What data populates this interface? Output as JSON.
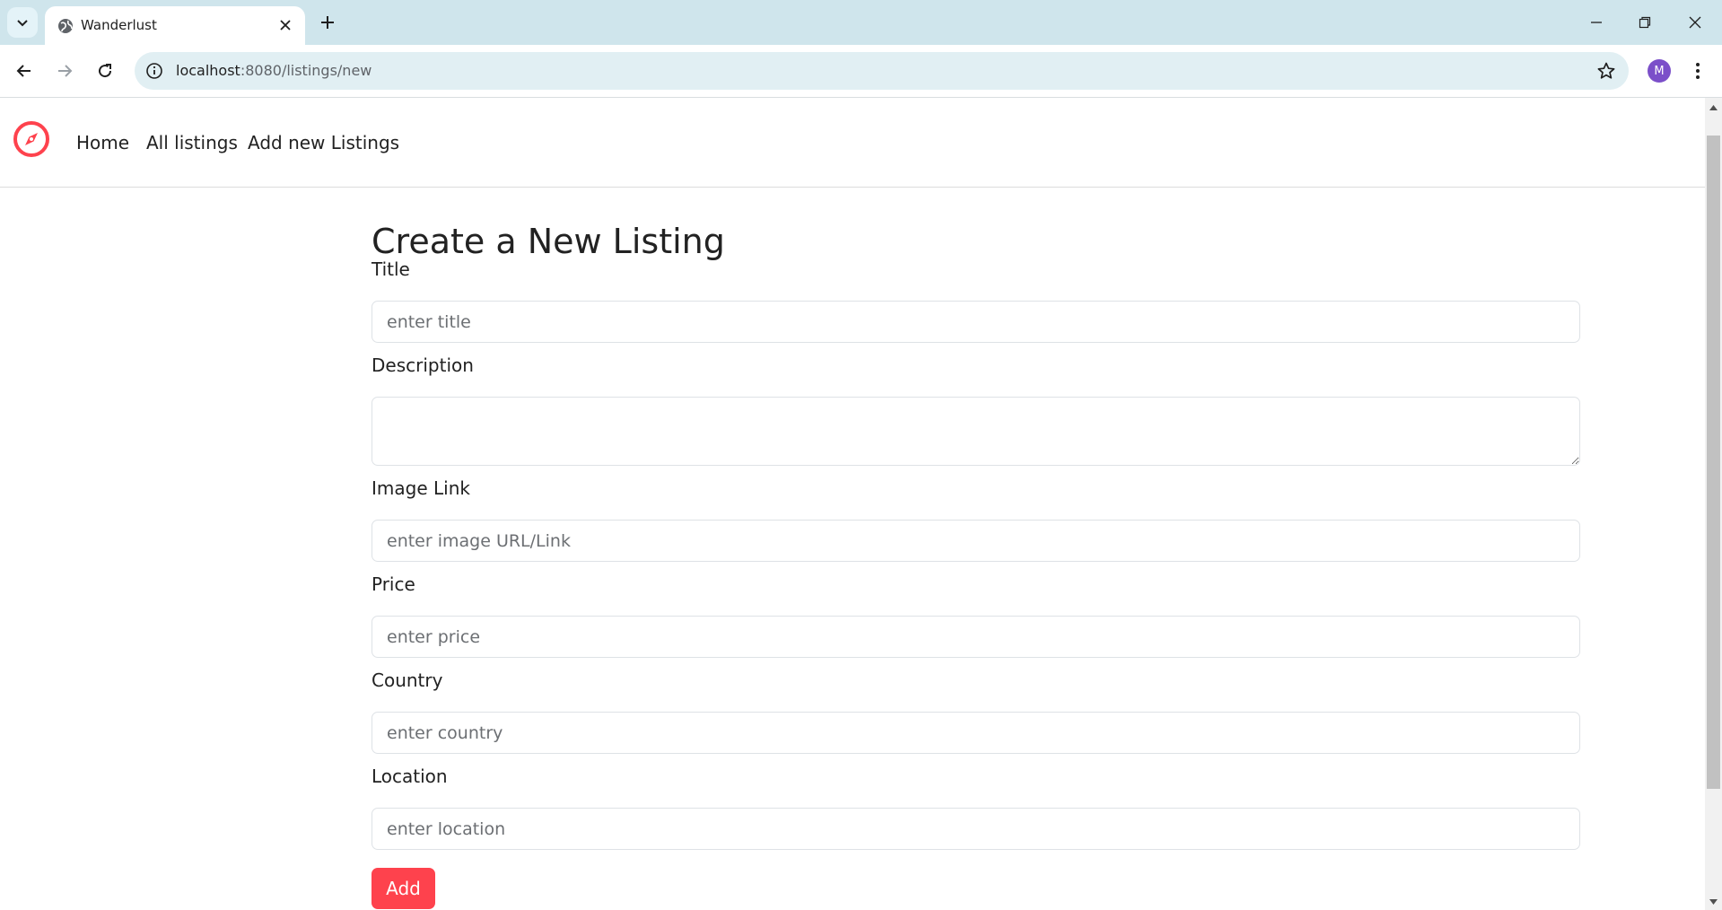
{
  "browser": {
    "tab": {
      "title": "Wanderlust"
    },
    "url": {
      "host": "localhost",
      "rest": ":8080/listings/new"
    },
    "avatar_initial": "M",
    "colors": {
      "tabstrip": "#cfe5ec",
      "omnibox": "#e1eff3",
      "avatar": "#7b4fc9"
    }
  },
  "nav": {
    "brand_icon": "compass-icon",
    "links": [
      {
        "label": "Home"
      },
      {
        "label": "All listings"
      },
      {
        "label": "Add new Listings"
      }
    ]
  },
  "form": {
    "heading": "Create a New Listing",
    "fields": {
      "title": {
        "label": "Title",
        "placeholder": "enter title",
        "value": ""
      },
      "description": {
        "label": "Description",
        "value": ""
      },
      "image": {
        "label": "Image Link",
        "placeholder": "enter image URL/Link",
        "value": ""
      },
      "price": {
        "label": "Price",
        "placeholder": "enter price",
        "value": ""
      },
      "country": {
        "label": "Country",
        "placeholder": "enter country",
        "value": ""
      },
      "location": {
        "label": "Location",
        "placeholder": "enter location",
        "value": ""
      }
    },
    "submit_label": "Add"
  },
  "theme": {
    "accent": "#fe424d"
  }
}
